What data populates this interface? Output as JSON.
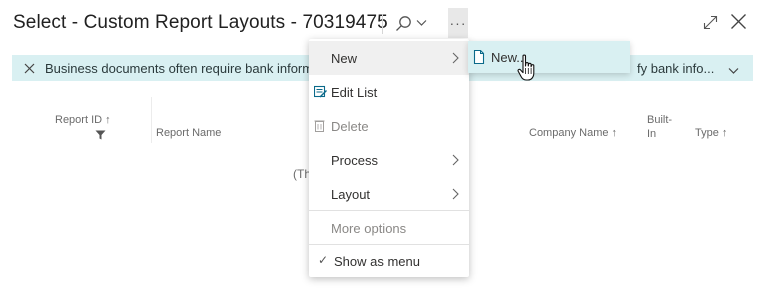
{
  "window": {
    "title": "Select - Custom Report Layouts - 70319475"
  },
  "notification": {
    "message_left": "Business documents often require bank informa",
    "message_right": "fy bank info..."
  },
  "table": {
    "columns": {
      "report_id": "Report ID",
      "report_id_sort": "↑",
      "report_name": "Report Name",
      "company_name": "Company Name",
      "company_name_sort": "↑",
      "built_in_line1": "Built-",
      "built_in_line2": "In",
      "type": "Type",
      "type_sort": "↑"
    },
    "empty_left": "(Th",
    "empty_right": ")"
  },
  "menu": {
    "items": [
      {
        "label": "New"
      },
      {
        "label": "Edit List"
      },
      {
        "label": "Delete"
      },
      {
        "label": "Process"
      },
      {
        "label": "Layout"
      },
      {
        "label": "More options"
      },
      {
        "label": "Show as menu",
        "check": "✓"
      }
    ]
  },
  "submenu": {
    "label": "New..."
  },
  "icons": {
    "more": "···"
  },
  "colors": {
    "notification_bg": "#d9f0f2",
    "menu_active_bg": "#f0f0f0",
    "accent": "#008489"
  }
}
